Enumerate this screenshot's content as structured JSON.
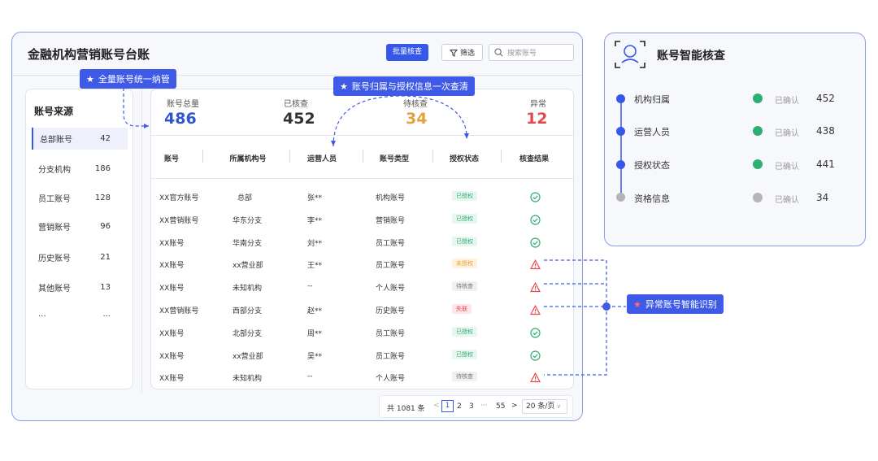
{
  "header": {
    "title": "金融机构营销账号台账",
    "batch_label": "批量核查",
    "filter_label": "筛选",
    "search_placeholder": "搜索账号"
  },
  "sidebar": {
    "title": "账号来源",
    "items": [
      {
        "label": "总部账号",
        "count": "42"
      },
      {
        "label": "分支机构",
        "count": "186"
      },
      {
        "label": "员工账号",
        "count": "128"
      },
      {
        "label": "营销账号",
        "count": "96"
      },
      {
        "label": "历史账号",
        "count": "21"
      },
      {
        "label": "其他账号",
        "count": "13"
      },
      {
        "label": "...",
        "count": "..."
      }
    ]
  },
  "stats": [
    {
      "label": "账号总量",
      "value": "486",
      "color": "#2f55d4"
    },
    {
      "label": "已核查",
      "value": "452",
      "color": "#333333"
    },
    {
      "label": "待核查",
      "value": "34",
      "color": "#e4a23c"
    },
    {
      "label": "异常",
      "value": "12",
      "color": "#e5484d"
    }
  ],
  "table": {
    "headers": [
      "账号",
      "所属机构号",
      "运营人员",
      "账号类型",
      "授权状态",
      "核查结果"
    ],
    "rows": [
      {
        "account": "XX官方账号",
        "org": "总部",
        "operator": "张**",
        "type": "机构账号",
        "auth": "已授权",
        "auth_kind": "ok",
        "result": "ok"
      },
      {
        "account": "XX营销账号",
        "org": "华东分支",
        "operator": "李**",
        "type": "营销账号",
        "auth": "已授权",
        "auth_kind": "ok",
        "result": "ok"
      },
      {
        "account": "XX账号",
        "org": "华南分支",
        "operator": "刘**",
        "type": "员工账号",
        "auth": "已授权",
        "auth_kind": "ok",
        "result": "ok"
      },
      {
        "account": "XX账号",
        "org": "xx营业部",
        "operator": "王**",
        "type": "员工账号",
        "auth": "未授权",
        "auth_kind": "warn",
        "result": "alert"
      },
      {
        "account": "XX账号",
        "org": "未知机构",
        "operator": "--",
        "type": "个人账号",
        "auth": "待核查",
        "auth_kind": "pending",
        "result": "alert"
      },
      {
        "account": "XX营销账号",
        "org": "西部分支",
        "operator": "赵**",
        "type": "历史账号",
        "auth": "失联",
        "auth_kind": "lost",
        "result": "alert"
      },
      {
        "account": "XX账号",
        "org": "北部分支",
        "operator": "周**",
        "type": "员工账号",
        "auth": "已授权",
        "auth_kind": "ok",
        "result": "ok"
      },
      {
        "account": "XX账号",
        "org": "xx营业部",
        "operator": "吴**",
        "type": "员工账号",
        "auth": "已授权",
        "auth_kind": "ok",
        "result": "ok"
      },
      {
        "account": "XX账号",
        "org": "未知机构",
        "operator": "--",
        "type": "个人账号",
        "auth": "待核查",
        "auth_kind": "pending",
        "result": "alert"
      }
    ]
  },
  "pager": {
    "total": "共 1081 条",
    "prev": "<",
    "p1": "1",
    "p2": "2",
    "p3": "3",
    "ellipsis": "···",
    "plast": "55",
    "next": ">",
    "page_size": "20 条/页"
  },
  "callouts": {
    "c1": "全量账号统一纳管",
    "c2": "账号归属与授权信息一次查清",
    "c3": "异常账号智能识别"
  },
  "right_panel": {
    "title": "账号智能核查",
    "items": [
      {
        "label": "机构归属",
        "state": "已确认",
        "value": "452",
        "color": "#2fae73"
      },
      {
        "label": "运营人员",
        "state": "已确认",
        "value": "438",
        "color": "#2fae73"
      },
      {
        "label": "授权状态",
        "state": "已确认",
        "value": "441",
        "color": "#2fae73"
      },
      {
        "label": "资格信息",
        "state": "已确认",
        "value": "34",
        "color": "#b5b5b5"
      }
    ]
  },
  "colors": {
    "accent": "#3558e8",
    "ok": "#2fae73",
    "alert": "#e5484d",
    "frame": "#8b9cf0"
  }
}
